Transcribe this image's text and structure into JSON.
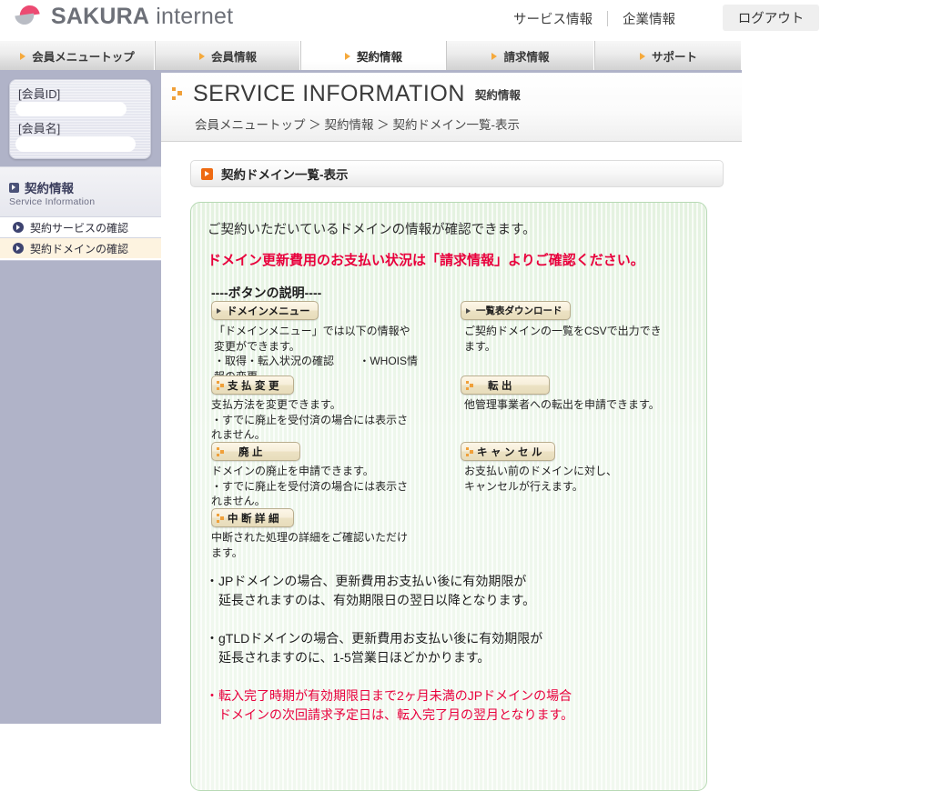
{
  "brand": {
    "name_bold": "SAKURA",
    "name_thin": " internet",
    "logo_icon": "sakura-petal-logo"
  },
  "topnav": {
    "links": [
      "サービス情報",
      "企業情報"
    ],
    "logout_label": "ログアウト"
  },
  "tabs": [
    {
      "label": "会員メニュートップ",
      "active": false
    },
    {
      "label": "会員情報",
      "active": false
    },
    {
      "label": "契約情報",
      "active": true
    },
    {
      "label": "請求情報",
      "active": false
    },
    {
      "label": "サポート",
      "active": false
    }
  ],
  "sidebar": {
    "member_box": {
      "id_label": "[会員ID]",
      "name_label": "[会員名]",
      "id_value": "",
      "name_value": ""
    },
    "section": {
      "title": "契約情報",
      "subtitle": "Service Information",
      "icon": "square-arrow-icon"
    },
    "items": [
      {
        "label": "契約サービスの確認",
        "selected": false
      },
      {
        "label": "契約ドメインの確認",
        "selected": true
      }
    ]
  },
  "service_header": {
    "title": "SERVICE INFORMATION",
    "subtitle": "契約情報",
    "breadcrumb": "会員メニュートップ ＞ 契約情報 ＞ 契約ドメイン一覧-表示",
    "icon": "orange-dots-icon"
  },
  "panel": {
    "title": "契約ドメイン一覧-表示",
    "title_icon": "orange-square-arrow-icon",
    "lead": "ご契約いただいているドメインの情報が確認できます。",
    "warning": "ドメイン更新費用のお支払い状況は「請求情報」よりご確認ください。",
    "buttons_heading": "----ボタンの説明----",
    "buttons_left": [
      {
        "label": "ドメインメニュー",
        "icon": "triangle-icon",
        "desc": "「ドメインメニュー」では以下の情報や\n変更ができます。\n・取得・転入状況の確認 　　・WHOIS情\n報の変更"
      },
      {
        "label": "支払変更",
        "icon": "orange-dots-icon",
        "desc": "支払方法を変更できます。\n・すでに廃止を受付済の場合には表示さ\nれません。"
      },
      {
        "label": "廃止",
        "icon": "orange-dots-icon",
        "desc": "ドメインの廃止を申請できます。\n・すでに廃止を受付済の場合には表示さ\nれません。"
      },
      {
        "label": "中断詳細",
        "icon": "orange-dots-icon",
        "desc": "中断された処理の詳細をご確認いただけ\nます。"
      }
    ],
    "buttons_right": [
      {
        "label": "一覧表ダウンロード",
        "icon": "triangle-icon",
        "desc": "ご契約ドメインの一覧をCSVで出力でき\nます。"
      },
      {
        "label": "転出",
        "icon": "orange-dots-icon",
        "desc": "他管理事業者への転出を申請できます。"
      },
      {
        "label": "キャンセル",
        "icon": "orange-dots-icon",
        "desc": "お支払い前のドメインに対し、\nキャンセルが行えます。"
      }
    ],
    "notes": [
      {
        "text": "・JPドメインの場合、更新費用お支払い後に有効期限が\n　延長されますのは、有効期限日の翌日以降となります。",
        "red": false
      },
      {
        "text": "・gTLDドメインの場合、更新費用お支払い後に有効期限が\n　延長されますのに、1-5営業日ほどかかります。",
        "red": false
      },
      {
        "text": "・転入完了時期が有効期限日まで2ヶ月未満のJPドメインの場合\n　ドメインの次回請求予定日は、転入完了月の翌月となります。",
        "red": true
      }
    ]
  },
  "colors": {
    "accent_orange": "#ee6a12",
    "warning_red": "#e8003c",
    "sidebar_bg": "#b0b3c8",
    "panel_green": "#eef7ec",
    "selected_item": "#fdf3e0"
  }
}
